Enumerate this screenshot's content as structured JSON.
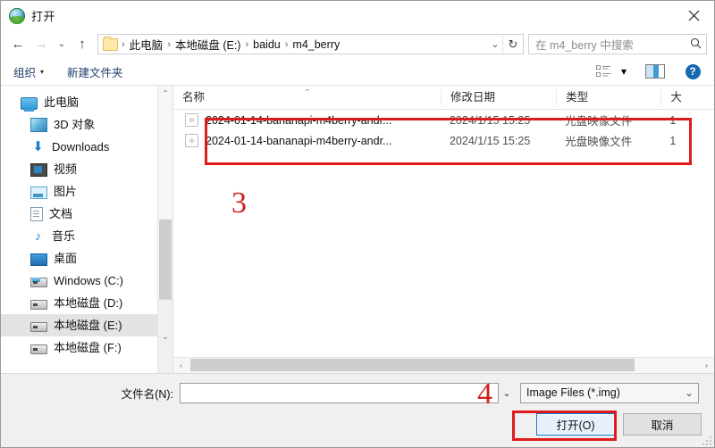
{
  "window": {
    "title": "打开",
    "app_icon": "open-dialog-icon",
    "close_label": "✕"
  },
  "nav": {
    "back_label": "←",
    "forward_label": "→",
    "history_label": "⌄",
    "up_label": "↑",
    "refresh_label": "↻",
    "breadcrumb": [
      "此电脑",
      "本地磁盘 (E:)",
      "baidu",
      "m4_berry"
    ],
    "breadcrumb_separator": "›",
    "breadcrumb_chevron": "⌄"
  },
  "search": {
    "placeholder": "在 m4_berry 中搜索",
    "icon": "search-icon"
  },
  "toolbar": {
    "organize_label": "组织",
    "organize_caret": "▾",
    "new_folder_label": "新建文件夹",
    "view_caret": "▾",
    "view_icon": "list-view-icon",
    "pane_icon": "preview-pane-icon",
    "help_label": "?"
  },
  "sidebar": {
    "items": [
      {
        "label": "此电脑",
        "icon": "this-pc-icon",
        "indent": false,
        "selected": false
      },
      {
        "label": "3D 对象",
        "icon": "3d-objects-icon",
        "indent": true,
        "selected": false
      },
      {
        "label": "Downloads",
        "icon": "downloads-icon",
        "indent": true,
        "selected": false
      },
      {
        "label": "视频",
        "icon": "videos-icon",
        "indent": true,
        "selected": false
      },
      {
        "label": "图片",
        "icon": "pictures-icon",
        "indent": true,
        "selected": false
      },
      {
        "label": "文档",
        "icon": "documents-icon",
        "indent": true,
        "selected": false
      },
      {
        "label": "音乐",
        "icon": "music-icon",
        "indent": true,
        "selected": false
      },
      {
        "label": "桌面",
        "icon": "desktop-icon",
        "indent": true,
        "selected": false
      },
      {
        "label": "Windows (C:)",
        "icon": "windows-drive-icon",
        "indent": true,
        "selected": false
      },
      {
        "label": "本地磁盘 (D:)",
        "icon": "local-drive-icon",
        "indent": true,
        "selected": false
      },
      {
        "label": "本地磁盘 (E:)",
        "icon": "local-drive-icon",
        "indent": true,
        "selected": true
      },
      {
        "label": "本地磁盘 (F:)",
        "icon": "local-drive-icon",
        "indent": true,
        "selected": false
      }
    ],
    "scroll_up": "⌃",
    "scroll_down": "⌄"
  },
  "filelist": {
    "columns": [
      {
        "key": "name",
        "label": "名称"
      },
      {
        "key": "date",
        "label": "修改日期"
      },
      {
        "key": "type",
        "label": "类型"
      },
      {
        "key": "size",
        "label": "大"
      }
    ],
    "sort_indicator": "⌃",
    "rows": [
      {
        "name": "2024-01-14-bananapi-m4berry-andr...",
        "date": "2024/1/15 15:25",
        "type": "光盘映像文件",
        "size": "1",
        "icon": "disc-image-file-icon"
      },
      {
        "name": "2024-01-14-bananapi-m4berry-andr...",
        "date": "2024/1/15 15:25",
        "type": "光盘映像文件",
        "size": "1",
        "icon": "disc-image-file-icon"
      }
    ],
    "hscroll_left": "‹",
    "hscroll_right": "›"
  },
  "form": {
    "filename_label": "文件名(N):",
    "filename_value": "",
    "filename_placeholder": "",
    "filename_caret": "⌄",
    "filter_value": "Image Files (*.img)",
    "filter_caret": "⌄",
    "open_button": "打开(O)",
    "cancel_button": "取消"
  },
  "annotations": [
    {
      "id": "3",
      "label": "3"
    },
    {
      "id": "4",
      "label": "4"
    }
  ],
  "colors": {
    "accent": "#0078d7",
    "annotation_red": "#e01b1b",
    "selection_gray": "#e3e3e3"
  }
}
